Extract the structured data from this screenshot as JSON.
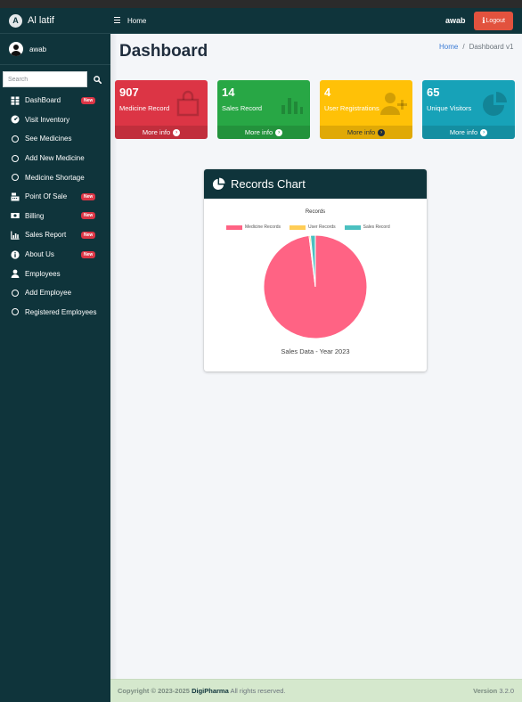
{
  "brand": {
    "name": "Al latif",
    "logo_letter": "A"
  },
  "user": {
    "name": "awab"
  },
  "search": {
    "placeholder": "Search"
  },
  "sidebar": {
    "badge_text": "New",
    "items": [
      {
        "label": "DashBoard",
        "icon": "gauge-icon",
        "badge": true
      },
      {
        "label": "Visit Inventory",
        "icon": "dashboard-dial-icon",
        "badge": false
      },
      {
        "label": "See Medicines",
        "icon": "circle-icon",
        "badge": false
      },
      {
        "label": "Add New Medicine",
        "icon": "circle-icon",
        "badge": false
      },
      {
        "label": "Medicine Shortage",
        "icon": "circle-icon",
        "badge": false
      },
      {
        "label": "Point Of Sale",
        "icon": "cash-register-icon",
        "badge": true
      },
      {
        "label": "Billing",
        "icon": "money-bill-icon",
        "badge": true
      },
      {
        "label": "Sales Report",
        "icon": "chart-bar-icon",
        "badge": true
      },
      {
        "label": "About Us",
        "icon": "info-circle-icon",
        "badge": true
      },
      {
        "label": "Employees",
        "icon": "user-icon",
        "badge": false
      },
      {
        "label": "Add Employee",
        "icon": "circle-icon",
        "badge": false
      },
      {
        "label": "Registered Employees",
        "icon": "circle-icon",
        "badge": false
      }
    ]
  },
  "topnav": {
    "home_label": "Home",
    "user_name": "awab",
    "logout_label": "Logout",
    "logout_icon_glyph": "ℹ"
  },
  "page": {
    "title": "Dashboard"
  },
  "breadcrumb": {
    "home": "Home",
    "separator": "/",
    "current": "Dashboard v1"
  },
  "info_boxes": {
    "more_info_label": "More info",
    "items": [
      {
        "value": "907",
        "label": "Medicine Record",
        "color": "#dc3545",
        "icon": "shopping-bag-icon"
      },
      {
        "value": "14",
        "label": "Sales Record",
        "color": "#28a745",
        "icon": "bar-chart-icon"
      },
      {
        "value": "4",
        "label": "User Registrations",
        "color": "#ffc107",
        "icon": "user-plus-icon"
      },
      {
        "value": "65",
        "label": "Unique Visitors",
        "color": "#17a2b8",
        "icon": "pie-chart-icon"
      }
    ]
  },
  "records_card": {
    "title": "Records Chart",
    "icon": "pie-chart-icon",
    "caption": "Sales Data - Year 2023"
  },
  "chart_data": {
    "type": "pie",
    "title": "Records",
    "categories": [
      "Medicine Records",
      "User Records",
      "Sales Record"
    ],
    "values": [
      907,
      4,
      14
    ],
    "colors": [
      "#ff6384",
      "#ffcd56",
      "#4bc0c0"
    ],
    "legend_position": "top"
  },
  "footer": {
    "copyright_prefix": "Copyright © 2023-2025",
    "brand": "DigiPharma",
    "rights": "All rights reserved.",
    "version_label": "Version",
    "version_number": "3.2.0"
  }
}
